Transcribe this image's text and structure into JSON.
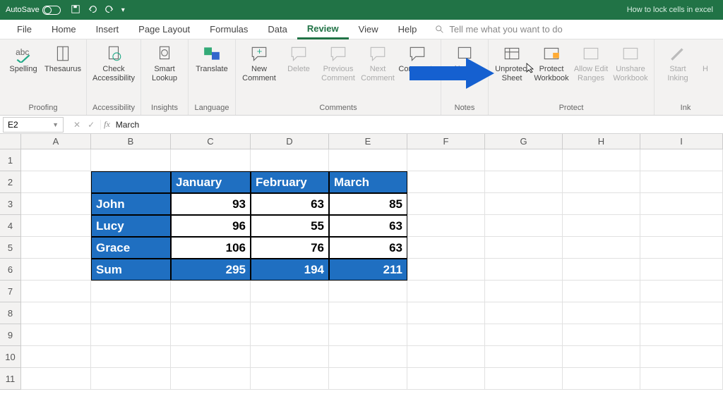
{
  "titlebar": {
    "autosave_label": "AutoSave",
    "doc_title": "How to lock cells in excel"
  },
  "tabs": {
    "file": "File",
    "home": "Home",
    "insert": "Insert",
    "pagelayout": "Page Layout",
    "formulas": "Formulas",
    "data": "Data",
    "review": "Review",
    "view": "View",
    "help": "Help",
    "tellme": "Tell me what you want to do"
  },
  "ribbon": {
    "spelling": "Spelling",
    "thesaurus": "Thesaurus",
    "proofing": "Proofing",
    "check_acc": "Check Accessibility",
    "accessibility": "Accessibility",
    "smart_lookup": "Smart Lookup",
    "insights": "Insights",
    "translate": "Translate",
    "language": "Language",
    "new_comment": "New Comment",
    "delete": "Delete",
    "prev_comment": "Previous Comment",
    "next_comment": "Next Comment",
    "comments_btn": "Comments",
    "comments": "Comments",
    "notes": "Notes",
    "unprotect": "Unprotect Sheet",
    "protect_wb": "Protect Workbook",
    "allow_edit": "Allow Edit Ranges",
    "unshare": "Unshare Workbook",
    "protect": "Protect",
    "start_inking": "Start Inking",
    "hide_ink": "H",
    "ink": "Ink"
  },
  "formula_bar": {
    "cell_ref": "E2",
    "value": "March"
  },
  "columns": [
    "A",
    "B",
    "C",
    "D",
    "E",
    "F",
    "G",
    "H",
    "I"
  ],
  "rows": [
    "1",
    "2",
    "3",
    "4",
    "5",
    "6",
    "7",
    "8",
    "9",
    "10",
    "11"
  ],
  "chart_data": {
    "type": "table",
    "title": "",
    "columns": [
      "",
      "January",
      "February",
      "March"
    ],
    "rows": [
      {
        "name": "John",
        "values": [
          93,
          63,
          85
        ]
      },
      {
        "name": "Lucy",
        "values": [
          96,
          55,
          63
        ]
      },
      {
        "name": "Grace",
        "values": [
          106,
          76,
          63
        ]
      },
      {
        "name": "Sum",
        "values": [
          295,
          194,
          211
        ]
      }
    ]
  }
}
